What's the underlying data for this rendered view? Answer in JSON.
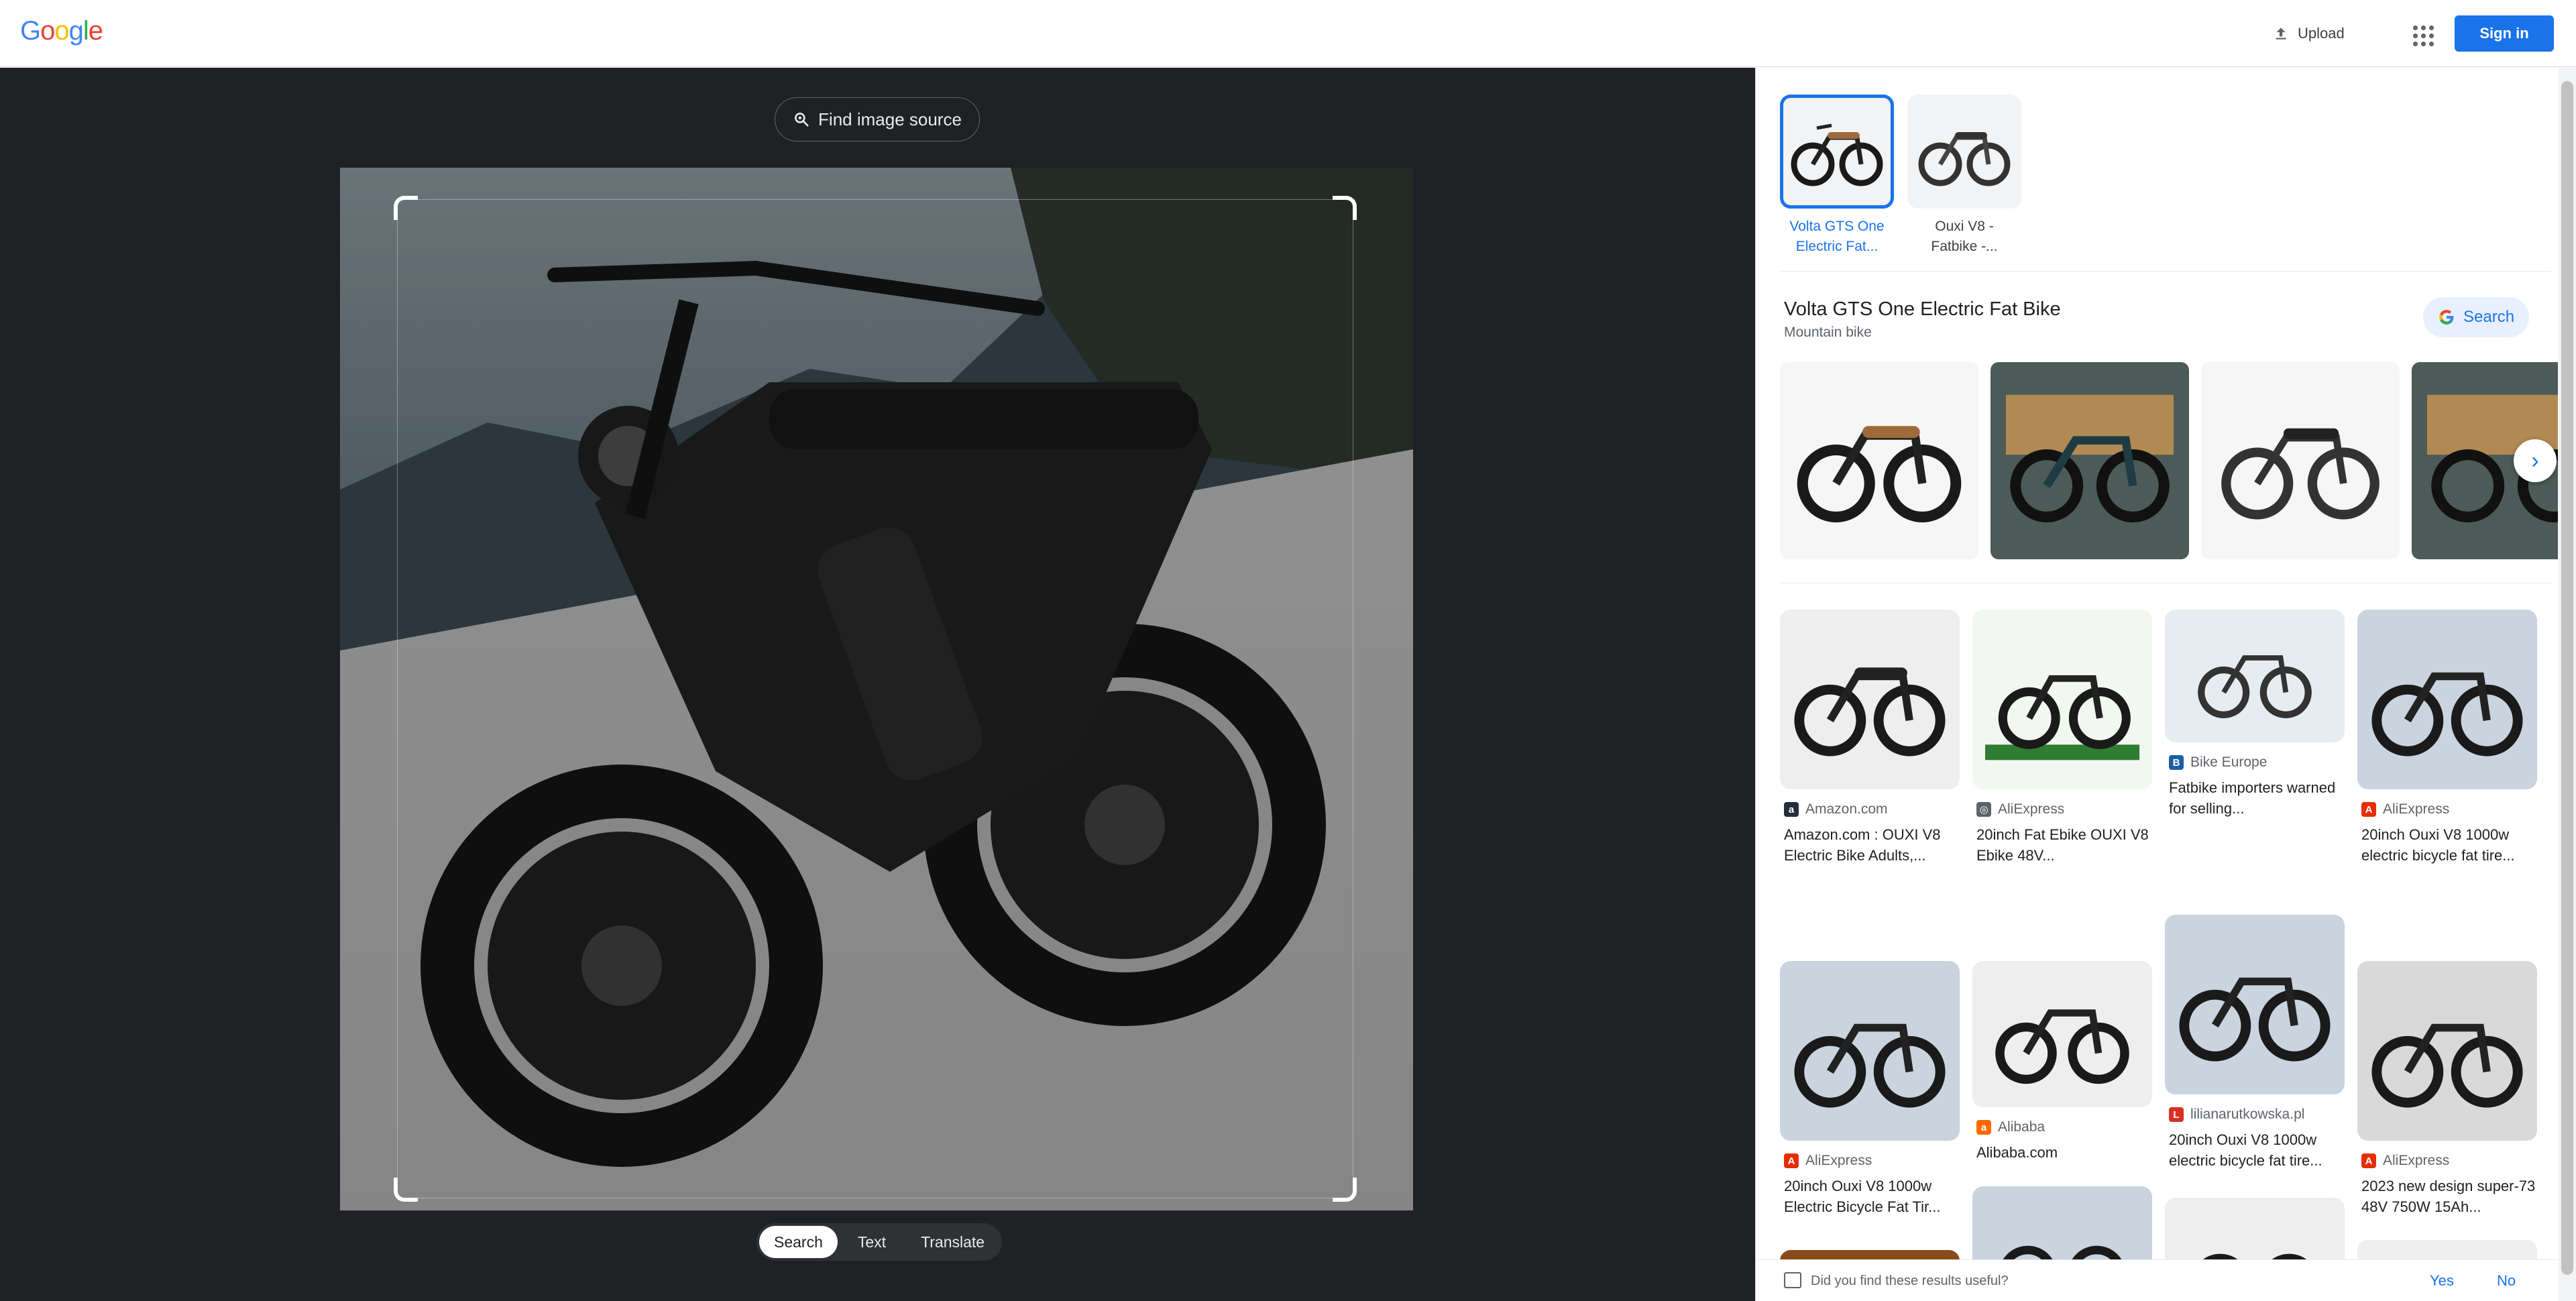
{
  "header": {
    "logo_letters": [
      "G",
      "o",
      "o",
      "g",
      "l",
      "e"
    ],
    "upload_label": "Upload",
    "signin_label": "Sign in"
  },
  "lens": {
    "find_source_label": "Find image source",
    "tabs": [
      "Search",
      "Text",
      "Translate"
    ],
    "active_tab": "Search"
  },
  "results": {
    "top_matches": [
      {
        "label": "Volta GTS One Electric Fat...",
        "selected": true
      },
      {
        "label": "Ouxi V8 - Fatbike -...",
        "selected": false
      }
    ],
    "entity": {
      "title": "Volta GTS One Electric Fat Bike",
      "subtitle": "Mountain bike",
      "search_label": "Search"
    },
    "grid": [
      {
        "source": "Amazon.com",
        "title": "Amazon.com : OUXI V8 Electric Bike Adults,..."
      },
      {
        "source": "AliExpress",
        "title": "20inch Fat Ebike OUXI V8 Ebike 48V..."
      },
      {
        "source": "Bike Europe",
        "title": "Fatbike importers warned for selling..."
      },
      {
        "source": "AliExpress",
        "title": "20inch Ouxi V8 1000w electric bicycle fat tire..."
      },
      {
        "source": "AliExpress",
        "title": "20inch Ouxi V8 1000w Electric Bicycle Fat Tir..."
      },
      {
        "source": "Alibaba",
        "title": "Alibaba.com"
      },
      {
        "source": "lilianarutkowska.pl",
        "title": "20inch Ouxi V8 1000w electric bicycle fat tire..."
      },
      {
        "source": "AliExpress",
        "title": "2023 new design super-73 48V 750W 15Ah..."
      }
    ],
    "feedback": {
      "question": "Did you find these results useful?",
      "yes": "Yes",
      "no": "No"
    }
  },
  "colors": {
    "accent": "#1a73e8",
    "dark_bg": "#202124",
    "amazon": "#232f3e",
    "aliexpress": "#e62e04",
    "alibaba": "#ff6a00",
    "bike_europe": "#1b5fa8",
    "liliana": "#d93025"
  },
  "icons": {
    "upload": "upload-icon",
    "apps": "apps-grid-icon",
    "lens": "lens-icon",
    "google_g": "google-g-icon",
    "next": "chevron-right-icon",
    "feedback": "feedback-icon"
  }
}
